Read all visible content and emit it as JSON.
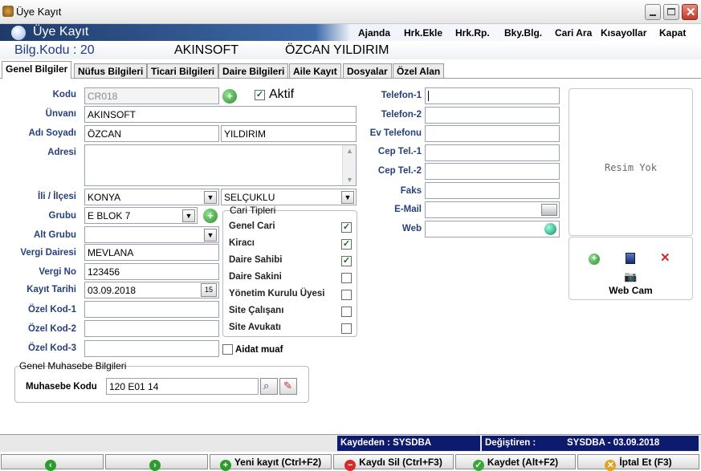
{
  "window": {
    "title": "Üye Kayıt"
  },
  "header": {
    "title": "Üye Kayıt"
  },
  "menu": [
    "Ajanda",
    "Hrk.Ekle",
    "Hrk.Rp.",
    "Bky.Blg.",
    "Cari Ara",
    "Kısayollar",
    "Kapat"
  ],
  "info": {
    "bilg_kodu": "Bilg.Kodu : 20",
    "company": "AKINSOFT",
    "person": "ÖZCAN YILDIRIM"
  },
  "tabs": [
    "Genel Bilgiler",
    "Nüfus Bilgileri",
    "Ticari Bilgileri",
    "Daire Bilgileri",
    "Aile Kayıt",
    "Dosyalar",
    "Özel Alan"
  ],
  "form": {
    "kod_label": "Kodu",
    "kod": "CR018",
    "aktif_label": "Aktif",
    "unvan_label": "Ünvanı",
    "unvan": "AKINSOFT",
    "adsoyad_label": "Adı Soyadı",
    "ad": "ÖZCAN",
    "soyad": "YILDIRIM",
    "adres_label": "Adresi",
    "adres": "",
    "il_label": "İli / İlçesi",
    "il": "KONYA",
    "ilce": "SELÇUKLU",
    "grup_label": "Grubu",
    "grup": "E BLOK 7",
    "altgrup_label": "Alt Grubu",
    "altgrup": "",
    "vd_label": "Vergi Dairesi",
    "vd": "MEVLANA",
    "vno_label": "Vergi No",
    "vno": "123456",
    "tarih_label": "Kayıt Tarihi",
    "tarih": "03.09.2018",
    "ok1_label": "Özel Kod-1",
    "ok2_label": "Özel Kod-2",
    "ok3_label": "Özel Kod-3",
    "aidat_label": "Aidat muaf"
  },
  "cari": {
    "title": "Cari Tipleri",
    "items": [
      {
        "label": "Genel Cari",
        "checked": true
      },
      {
        "label": "Kiracı",
        "checked": true
      },
      {
        "label": "Daire Sahibi",
        "checked": true
      },
      {
        "label": "Daire Sakini",
        "checked": false
      },
      {
        "label": "Yönetim Kurulu Üyesi",
        "checked": false
      },
      {
        "label": "Site Çalışanı",
        "checked": false
      },
      {
        "label": "Site Avukatı",
        "checked": false
      }
    ]
  },
  "contact": {
    "tel1_label": "Telefon-1",
    "tel2_label": "Telefon-2",
    "evtel_label": "Ev Telefonu",
    "cep1_label": "Cep Tel.-1",
    "cep2_label": "Cep Tel.-2",
    "faks_label": "Faks",
    "email_label": "E-Mail",
    "web_label": "Web"
  },
  "photo": {
    "empty": "Resim Yok",
    "webcam": "Web Cam"
  },
  "muhasebe": {
    "title": "Genel Muhasebe Bilgileri",
    "label": "Muhasebe Kodu",
    "value": "120 E01 14"
  },
  "status": {
    "kaydeden": "Kaydeden : SYSDBA",
    "degistiren_label": "Değiştiren :",
    "degistiren": "SYSDBA - 03.09.2018"
  },
  "buttons": {
    "yeni": "Yeni kayıt (Ctrl+F2)",
    "sil": "Kaydı Sil (Ctrl+F3)",
    "kaydet": "Kaydet (Alt+F2)",
    "iptal": "İptal Et (F3)"
  }
}
